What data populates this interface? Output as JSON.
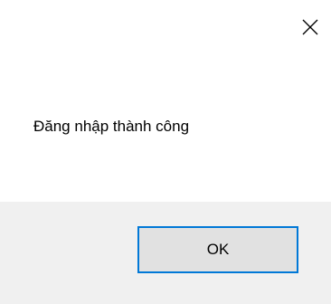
{
  "dialog": {
    "close_icon": "close-icon",
    "message": "Đăng nhập thành công",
    "ok_label": "OK",
    "colors": {
      "footer_background": "#f0f0f0",
      "button_background": "#e1e1e1",
      "button_focus_border": "#0078d7"
    }
  }
}
